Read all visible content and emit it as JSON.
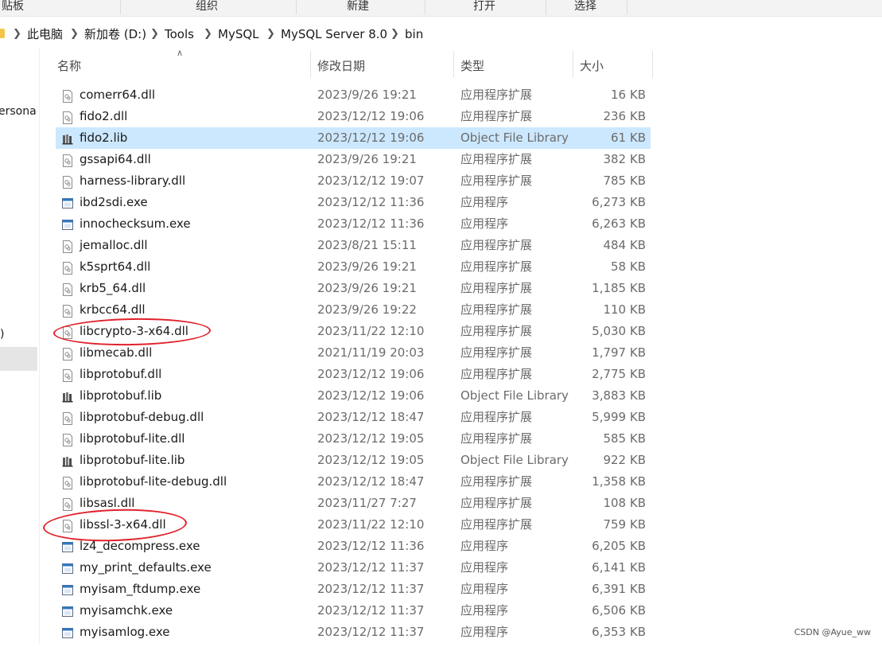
{
  "ribbon": {
    "clipboard": "贴板",
    "organize": "组织",
    "new": "新建",
    "open": "打开",
    "select": "选择"
  },
  "breadcrumb": [
    "此电脑",
    "新加卷 (D:)",
    "Tools",
    "MySQL",
    "MySQL Server 8.0",
    "bin"
  ],
  "nav": {
    "partial_item": "ersona",
    "partial_paren": ")"
  },
  "columns": {
    "name": "名称",
    "date": "修改日期",
    "type": "类型",
    "size": "大小"
  },
  "files": [
    {
      "name": "comerr64.dll",
      "date": "2023/9/26 19:21",
      "type": "应用程序扩展",
      "size": "16 KB",
      "icon": "dll-icon"
    },
    {
      "name": "fido2.dll",
      "date": "2023/12/12 19:06",
      "type": "应用程序扩展",
      "size": "236 KB",
      "icon": "dll-icon"
    },
    {
      "name": "fido2.lib",
      "date": "2023/12/12 19:06",
      "type": "Object File Library",
      "size": "61 KB",
      "icon": "lib-icon"
    },
    {
      "name": "gssapi64.dll",
      "date": "2023/9/26 19:21",
      "type": "应用程序扩展",
      "size": "382 KB",
      "icon": "dll-icon"
    },
    {
      "name": "harness-library.dll",
      "date": "2023/12/12 19:07",
      "type": "应用程序扩展",
      "size": "785 KB",
      "icon": "dll-icon"
    },
    {
      "name": "ibd2sdi.exe",
      "date": "2023/12/12 11:36",
      "type": "应用程序",
      "size": "6,273 KB",
      "icon": "exe-icon"
    },
    {
      "name": "innochecksum.exe",
      "date": "2023/12/12 11:36",
      "type": "应用程序",
      "size": "6,263 KB",
      "icon": "exe-icon"
    },
    {
      "name": "jemalloc.dll",
      "date": "2023/8/21 15:11",
      "type": "应用程序扩展",
      "size": "484 KB",
      "icon": "dll-icon"
    },
    {
      "name": "k5sprt64.dll",
      "date": "2023/9/26 19:21",
      "type": "应用程序扩展",
      "size": "58 KB",
      "icon": "dll-icon"
    },
    {
      "name": "krb5_64.dll",
      "date": "2023/9/26 19:21",
      "type": "应用程序扩展",
      "size": "1,185 KB",
      "icon": "dll-icon"
    },
    {
      "name": "krbcc64.dll",
      "date": "2023/9/26 19:22",
      "type": "应用程序扩展",
      "size": "110 KB",
      "icon": "dll-icon"
    },
    {
      "name": "libcrypto-3-x64.dll",
      "date": "2023/11/22 12:10",
      "type": "应用程序扩展",
      "size": "5,030 KB",
      "icon": "dll-icon"
    },
    {
      "name": "libmecab.dll",
      "date": "2021/11/19 20:03",
      "type": "应用程序扩展",
      "size": "1,797 KB",
      "icon": "dll-icon"
    },
    {
      "name": "libprotobuf.dll",
      "date": "2023/12/12 19:06",
      "type": "应用程序扩展",
      "size": "2,775 KB",
      "icon": "dll-icon"
    },
    {
      "name": "libprotobuf.lib",
      "date": "2023/12/12 19:06",
      "type": "Object File Library",
      "size": "3,883 KB",
      "icon": "lib-icon"
    },
    {
      "name": "libprotobuf-debug.dll",
      "date": "2023/12/12 18:47",
      "type": "应用程序扩展",
      "size": "5,999 KB",
      "icon": "dll-icon"
    },
    {
      "name": "libprotobuf-lite.dll",
      "date": "2023/12/12 19:05",
      "type": "应用程序扩展",
      "size": "585 KB",
      "icon": "dll-icon"
    },
    {
      "name": "libprotobuf-lite.lib",
      "date": "2023/12/12 19:05",
      "type": "Object File Library",
      "size": "922 KB",
      "icon": "lib-icon"
    },
    {
      "name": "libprotobuf-lite-debug.dll",
      "date": "2023/12/12 18:47",
      "type": "应用程序扩展",
      "size": "1,358 KB",
      "icon": "dll-icon"
    },
    {
      "name": "libsasl.dll",
      "date": "2023/11/27 7:27",
      "type": "应用程序扩展",
      "size": "108 KB",
      "icon": "dll-icon"
    },
    {
      "name": "libssl-3-x64.dll",
      "date": "2023/11/22 12:10",
      "type": "应用程序扩展",
      "size": "759 KB",
      "icon": "dll-icon"
    },
    {
      "name": "lz4_decompress.exe",
      "date": "2023/12/12 11:36",
      "type": "应用程序",
      "size": "6,205 KB",
      "icon": "exe-icon"
    },
    {
      "name": "my_print_defaults.exe",
      "date": "2023/12/12 11:37",
      "type": "应用程序",
      "size": "6,141 KB",
      "icon": "exe-icon"
    },
    {
      "name": "myisam_ftdump.exe",
      "date": "2023/12/12 11:37",
      "type": "应用程序",
      "size": "6,391 KB",
      "icon": "exe-icon"
    },
    {
      "name": "myisamchk.exe",
      "date": "2023/12/12 11:37",
      "type": "应用程序",
      "size": "6,506 KB",
      "icon": "exe-icon"
    },
    {
      "name": "myisamlog.exe",
      "date": "2023/12/12 11:37",
      "type": "应用程序",
      "size": "6,353 KB",
      "icon": "exe-icon"
    }
  ],
  "selected_file": "fido2.lib",
  "annotated_files": [
    "libcrypto-3-x64.dll",
    "libssl-3-x64.dll"
  ],
  "annotation_color": "#e0212b",
  "selection_color": "#cce8ff",
  "watermark": "CSDN @Ayue_ww"
}
